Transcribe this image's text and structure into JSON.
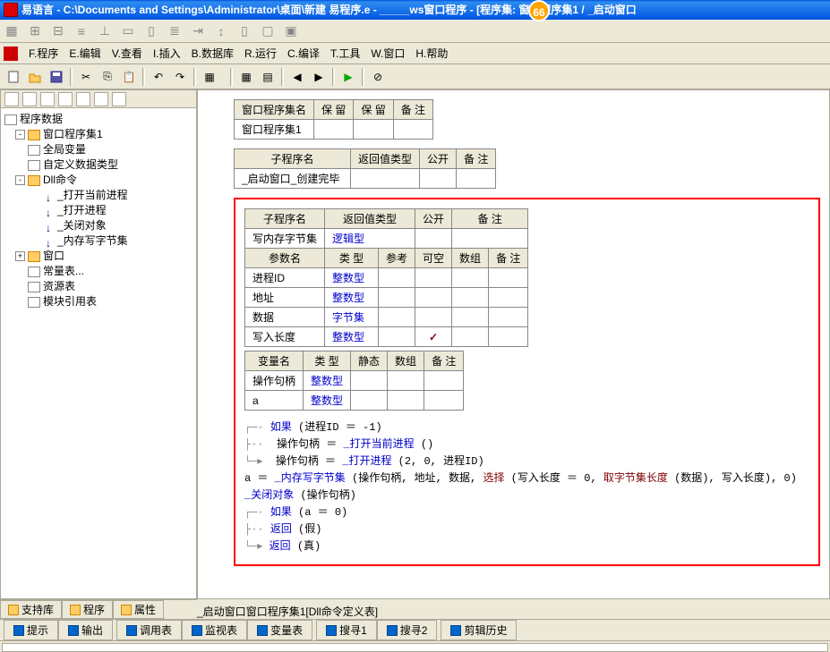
{
  "title": "易语言 - C:\\Documents and Settings\\Administrator\\桌面\\新建 易程序.e - _____ws窗口程序 - [程序集: 窗口程序集1 / _启动窗口",
  "badge": "66",
  "menus": [
    "F.程序",
    "E.编辑",
    "V.查看",
    "I.插入",
    "B.数据库",
    "R.运行",
    "C.编译",
    "T.工具",
    "W.窗口",
    "H.帮助"
  ],
  "tree": {
    "root": "程序数据",
    "items": [
      {
        "exp": "-",
        "ind": 0,
        "icon": "folder",
        "label": "窗口程序集1"
      },
      {
        "exp": "",
        "ind": 0,
        "icon": "doc",
        "label": "全局变量"
      },
      {
        "exp": "",
        "ind": 0,
        "icon": "doc",
        "label": "自定义数据类型"
      },
      {
        "exp": "-",
        "ind": 0,
        "icon": "folder",
        "label": "Dll命令"
      },
      {
        "exp": "",
        "ind": 1,
        "icon": "arrow",
        "label": "_打开当前进程"
      },
      {
        "exp": "",
        "ind": 1,
        "icon": "arrow",
        "label": "_打开进程"
      },
      {
        "exp": "",
        "ind": 1,
        "icon": "arrow",
        "label": "_关闭对象"
      },
      {
        "exp": "",
        "ind": 1,
        "icon": "arrow",
        "label": "_内存写字节集"
      },
      {
        "exp": "+",
        "ind": 0,
        "icon": "folder",
        "label": "窗口"
      },
      {
        "exp": "",
        "ind": 0,
        "icon": "doc",
        "label": "常量表..."
      },
      {
        "exp": "",
        "ind": 0,
        "icon": "doc",
        "label": "资源表"
      },
      {
        "exp": "",
        "ind": 0,
        "icon": "doc",
        "label": "模块引用表"
      }
    ]
  },
  "sidebar_tabs": [
    "支持库",
    "程序",
    "属性"
  ],
  "table1": {
    "headers": [
      "窗口程序集名",
      "保 留",
      "保 留",
      "备 注"
    ],
    "row": [
      "窗口程序集1",
      "",
      "",
      ""
    ]
  },
  "table2": {
    "headers": [
      "子程序名",
      "返回值类型",
      "公开",
      "备 注"
    ],
    "row": [
      "_启动窗口_创建完毕",
      "",
      "",
      ""
    ]
  },
  "table3a": {
    "r1": [
      "子程序名",
      "返回值类型",
      "公开",
      "备 注"
    ],
    "r2": [
      "写内存字节集",
      "逻辑型",
      "",
      ""
    ],
    "r3": [
      "参数名",
      "类 型",
      "参考",
      "可空",
      "数组",
      "备 注"
    ],
    "rows": [
      [
        "进程ID",
        "整数型",
        "",
        "",
        "",
        ""
      ],
      [
        "地址",
        "整数型",
        "",
        "",
        "",
        ""
      ],
      [
        "数据",
        "字节集",
        "",
        "",
        "",
        ""
      ],
      [
        "写入长度",
        "整数型",
        "",
        "✓",
        "",
        ""
      ]
    ]
  },
  "table3b": {
    "headers": [
      "变量名",
      "类 型",
      "静态",
      "数组",
      "备 注"
    ],
    "rows": [
      [
        "操作句柄",
        "整数型",
        "",
        "",
        ""
      ],
      [
        "a",
        "整数型",
        "",
        "",
        ""
      ]
    ]
  },
  "code": {
    "l1a": "如果",
    "l1b": "(进程ID ＝ -1)",
    "l2a": "操作句柄 ＝ ",
    "l2b": "_打开当前进程",
    "l2c": " ()",
    "l3a": "操作句柄 ＝ ",
    "l3b": "_打开进程",
    "l3c": " (2, 0, ",
    "l3d": "进程ID",
    "l3e": ")",
    "l4a": "a ＝ ",
    "l4b": "_内存写字节集",
    "l4c": " (操作句柄, 地址, 数据, ",
    "l4d": "选择",
    "l4e": " (写入长度 ＝ 0, ",
    "l4f": "取字节集长度",
    "l4g": " (数据), 写入长度), 0)",
    "l5a": "_关闭对象",
    "l5b": " (操作句柄)",
    "l6a": "如果",
    "l6b": "(a ＝ 0)",
    "l7a": "返回",
    "l7b": "(假)",
    "l8a": "返回",
    "l8b": "(真)"
  },
  "bottom_tabs": [
    "_启动窗口",
    "窗口程序集1",
    "[Dll命令定义表]"
  ],
  "panel_tabs": [
    "提示",
    "输出",
    "调用表",
    "监视表",
    "变量表",
    "搜寻1",
    "搜寻2",
    "剪辑历史"
  ]
}
